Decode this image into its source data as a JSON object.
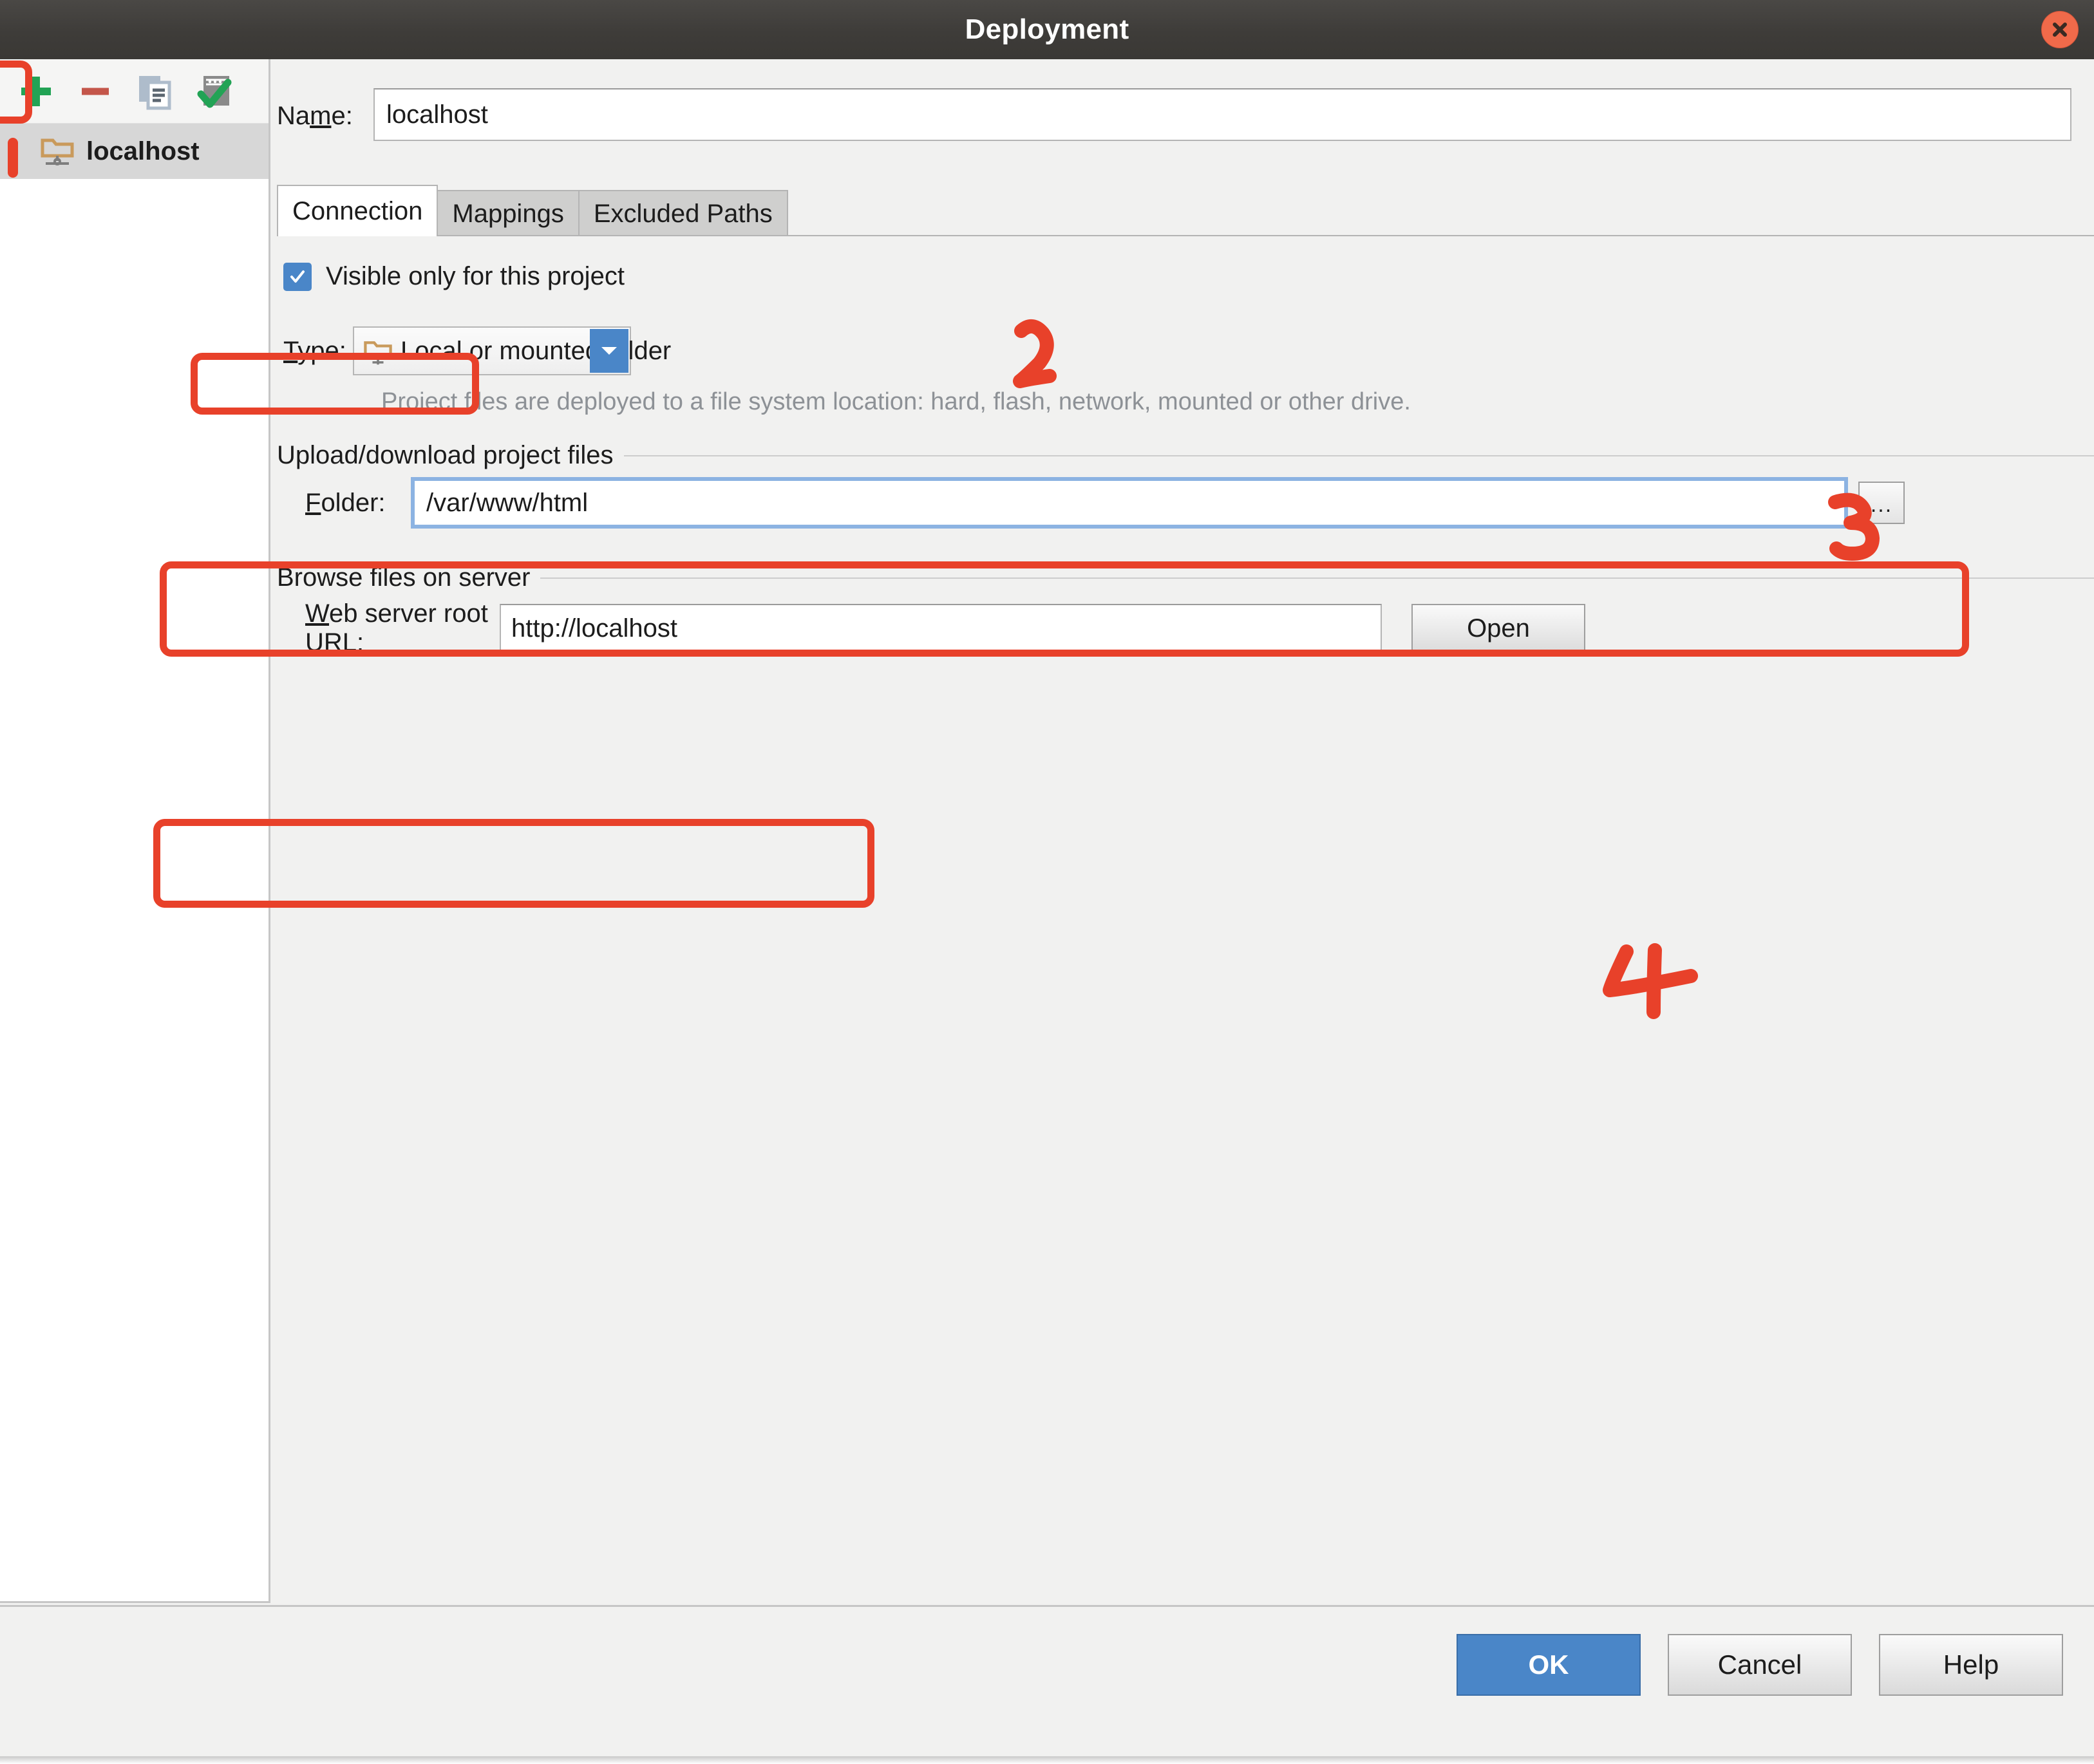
{
  "window": {
    "title": "Deployment",
    "close_icon": "close-icon"
  },
  "tree": {
    "toolbar": [
      {
        "name": "add-button",
        "icon": "plus-icon",
        "tooltip": "Add"
      },
      {
        "name": "remove-button",
        "icon": "minus-icon",
        "tooltip": "Remove"
      },
      {
        "name": "copy-button",
        "icon": "copy-icon",
        "tooltip": "Copy"
      },
      {
        "name": "set-default-button",
        "icon": "server-check-icon",
        "tooltip": "Use as default"
      }
    ],
    "items": [
      {
        "label": "localhost",
        "icon": "local-folder-server-icon",
        "selected": true
      }
    ]
  },
  "form": {
    "name_label": "Na",
    "name_label_mnemonic": "m",
    "name_label_rest": "e:",
    "name_value": "localhost"
  },
  "tabs": [
    {
      "label": "Connection",
      "active": true
    },
    {
      "label": "Mappings",
      "active": false
    },
    {
      "label": "Excluded Paths",
      "active": false
    }
  ],
  "connection": {
    "visible_only_label": "Visible only for this project",
    "visible_only_checked": true,
    "type_label_mnemonic": "T",
    "type_label_rest": "ype:",
    "type_value": "Local or mounted folder",
    "type_icon": "local-folder-server-icon",
    "type_description": "Project files are deployed to a file system location: hard, flash, network, mounted or other drive.",
    "group_upload_title": "Upload/download project files",
    "folder_label_mnemonic": "F",
    "folder_label_rest": "older:",
    "folder_value": "/var/www/html",
    "folder_browse_label": "...",
    "group_browse_title": "Browse files on server",
    "url_label_mnemonic": "W",
    "url_label_rest": "eb server root URL:",
    "url_value": "http://localhost",
    "open_button_label": "Open"
  },
  "footer": {
    "ok_label": "OK",
    "cancel_label": "Cancel",
    "help_label": "Help"
  },
  "annotations": {
    "marks": [
      {
        "id": "1",
        "glyph": "1",
        "style": "stroke"
      },
      {
        "id": "2",
        "glyph": "2"
      },
      {
        "id": "3",
        "glyph": "3"
      },
      {
        "id": "4",
        "glyph": "4"
      }
    ],
    "color": "#e8412a"
  }
}
